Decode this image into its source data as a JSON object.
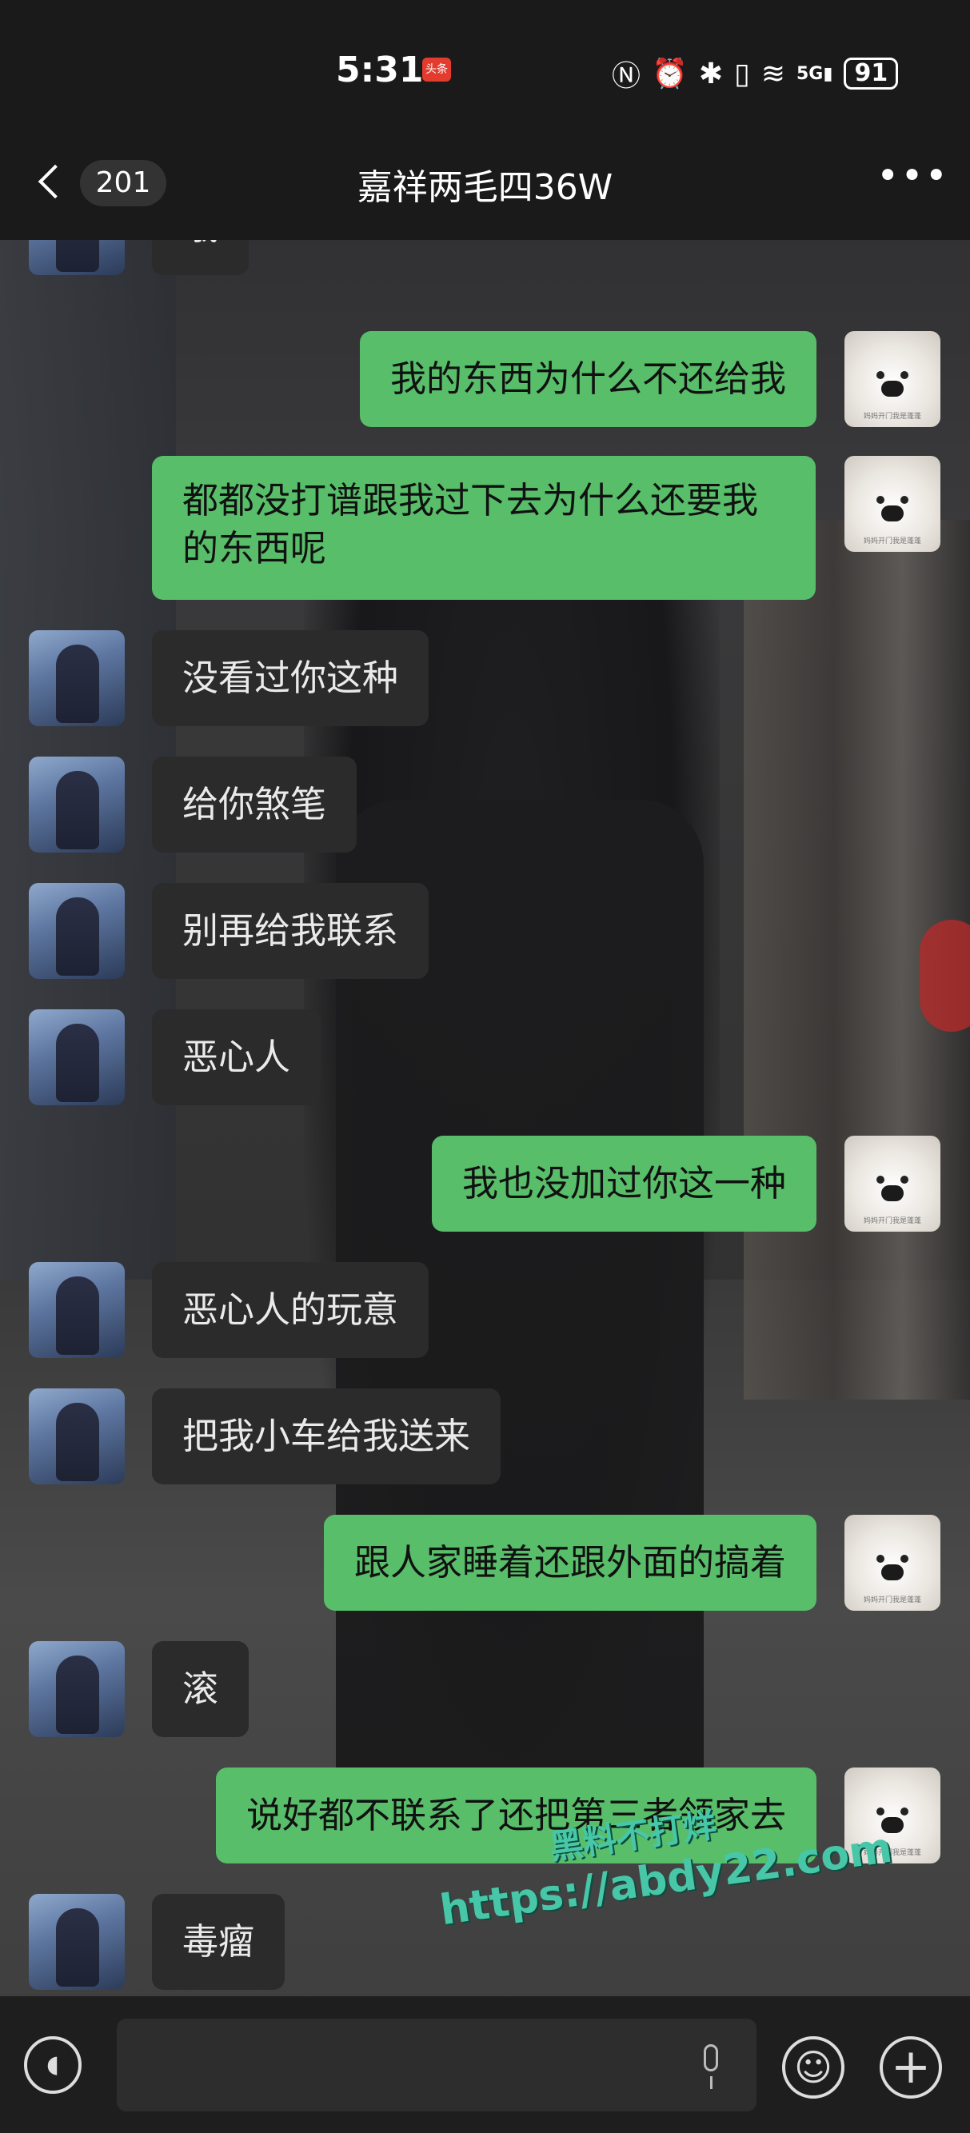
{
  "status_bar": {
    "time": "5:31",
    "app_badge": "头条",
    "icons": [
      "nfc-icon",
      "alarm-icon",
      "bluetooth-icon",
      "vibrate-icon",
      "wifi-icon",
      "signal-5g-icon"
    ],
    "signal_label": "5G",
    "battery": "91"
  },
  "header": {
    "unread_count": "201",
    "title": "嘉祥两毛四36W",
    "more": "•••"
  },
  "messages": [
    {
      "side": "in",
      "text": "哦"
    },
    {
      "side": "out",
      "text": "我的东西为什么不还给我"
    },
    {
      "side": "out",
      "text": "都都没打谱跟我过下去为什么还要我的东西呢"
    },
    {
      "side": "in",
      "text": "没看过你这种"
    },
    {
      "side": "in",
      "text": "给你煞笔"
    },
    {
      "side": "in",
      "text": "别再给我联系"
    },
    {
      "side": "in",
      "text": "恶心人"
    },
    {
      "side": "out",
      "text": "我也没加过你这一种"
    },
    {
      "side": "in",
      "text": "恶心人的玩意"
    },
    {
      "side": "in",
      "text": "把我小车给我送来"
    },
    {
      "side": "out",
      "text": "跟人家睡着还跟外面的搞着"
    },
    {
      "side": "in",
      "text": "滚"
    },
    {
      "side": "out",
      "text": "说好都不联系了还把第三者领家去"
    },
    {
      "side": "in",
      "text": "毒瘤"
    }
  ],
  "avatar_caption": "妈妈开门我是蓬蓬",
  "watermark": {
    "line1": "黑料不打烊",
    "line2": "https://abdy22.com"
  },
  "input_bar": {
    "placeholder": ""
  }
}
